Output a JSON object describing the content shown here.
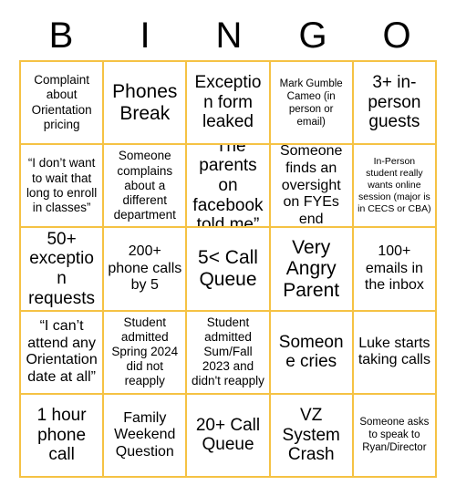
{
  "card": {
    "title": "BINGO",
    "header_letters": [
      "B",
      "I",
      "N",
      "G",
      "O"
    ],
    "grid_border_color": "#f5c244",
    "text_color": "#000000",
    "background_color": "#ffffff",
    "columns": 5,
    "rows": 5,
    "cells": [
      {
        "text": "Complaint about Orientation pricing",
        "size": "fs-sm"
      },
      {
        "text": "Phones Break",
        "size": "fs-xl"
      },
      {
        "text": "Exception form leaked",
        "size": "fs-lg"
      },
      {
        "text": "Mark Gumble Cameo (in person or email)",
        "size": "fs-xs"
      },
      {
        "text": "3+ in-person guests",
        "size": "fs-lg"
      },
      {
        "text": "“I don’t want to wait that long to enroll in classes”",
        "size": "fs-sm"
      },
      {
        "text": "Someone complains about a different department",
        "size": "fs-sm"
      },
      {
        "text": "“The parents on facebook told me”",
        "size": "fs-lg"
      },
      {
        "text": "Someone finds an oversight on FYEs end",
        "size": "fs-md"
      },
      {
        "text": "In-Person student really wants online session (major is in CECS or CBA)",
        "size": "fs-xxs"
      },
      {
        "text": "50+ exception requests",
        "size": "fs-lg"
      },
      {
        "text": "200+ phone calls by 5",
        "size": "fs-md"
      },
      {
        "text": "5< Call Queue",
        "size": "fs-xl"
      },
      {
        "text": "Very Angry Parent",
        "size": "fs-xl"
      },
      {
        "text": "100+ emails in the inbox",
        "size": "fs-md"
      },
      {
        "text": "“I can’t attend any Orientation date at all”",
        "size": "fs-md"
      },
      {
        "text": "Student admitted Spring 2024 did not reapply",
        "size": "fs-sm"
      },
      {
        "text": "Student admitted Sum/Fall 2023 and didn't reapply",
        "size": "fs-sm"
      },
      {
        "text": "Someone cries",
        "size": "fs-lg"
      },
      {
        "text": "Luke starts taking calls",
        "size": "fs-md"
      },
      {
        "text": "1 hour phone call",
        "size": "fs-lg"
      },
      {
        "text": "Family Weekend Question",
        "size": "fs-md"
      },
      {
        "text": "20+ Call Queue",
        "size": "fs-lg"
      },
      {
        "text": "VZ System Crash",
        "size": "fs-lg"
      },
      {
        "text": "Someone asks to speak to Ryan/Director",
        "size": "fs-xs"
      }
    ]
  }
}
